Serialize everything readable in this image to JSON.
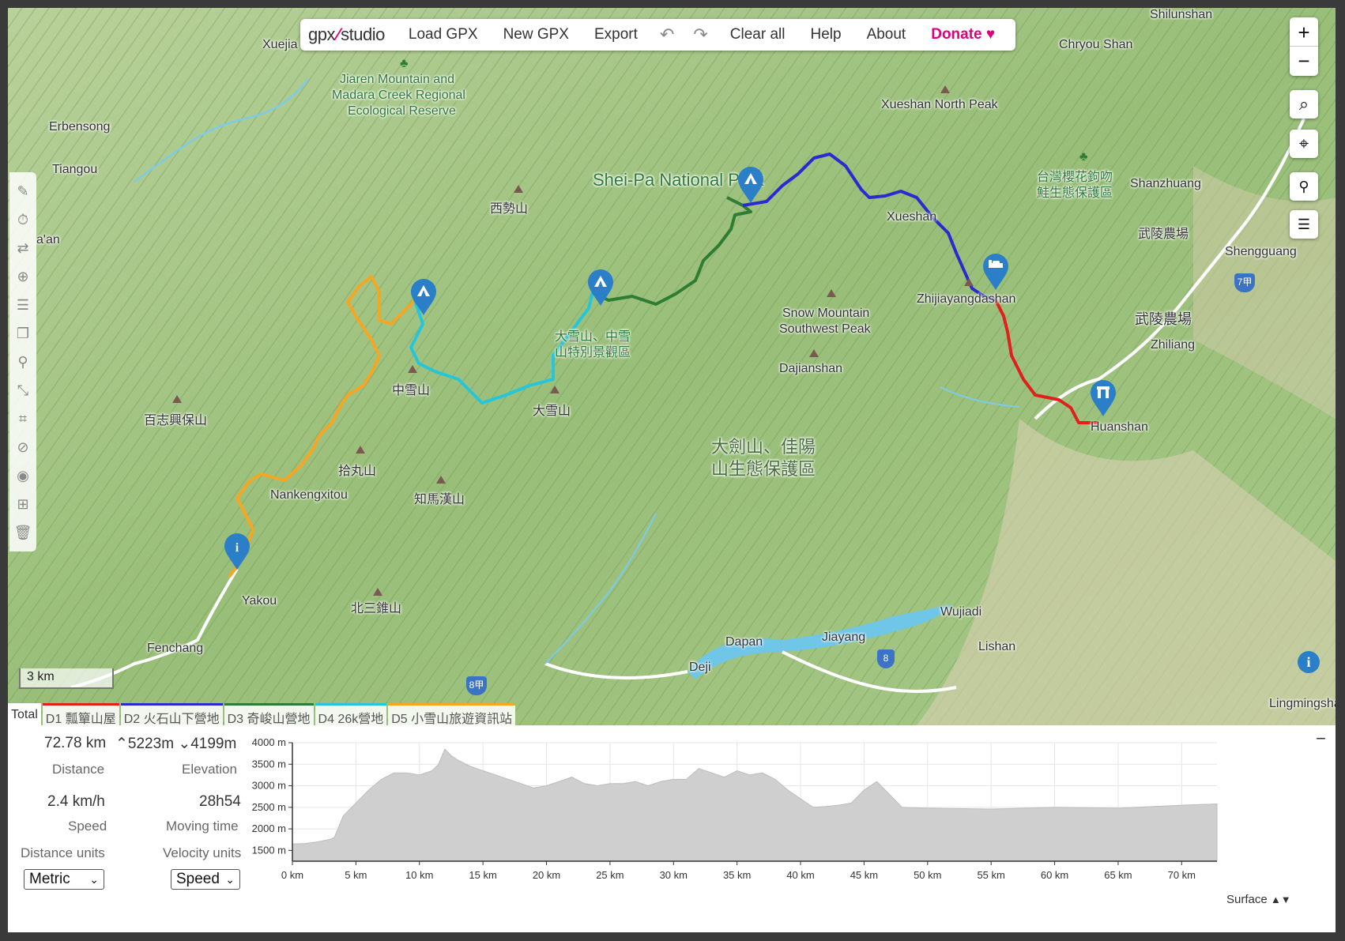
{
  "toolbar": {
    "logo_left": "gpx",
    "logo_right": "studio",
    "load": "Load GPX",
    "new": "New GPX",
    "export": "Export",
    "undo_icon": "undo-icon",
    "redo_icon": "redo-icon",
    "clear": "Clear all",
    "help": "Help",
    "about": "About",
    "donate": "Donate"
  },
  "map": {
    "labels": {
      "xuejia": "Xuejia",
      "reserve1": "Jiaren Mountain and",
      "reserve2": "Madara Creek Regional",
      "reserve3": "Ecological Reserve",
      "erbensong": "Erbensong",
      "tiangou": "Tiangou",
      "aan": "a'an",
      "xishi": "西勢山",
      "sheipa": "Shei-Pa National Park",
      "shilunshan": "Shilunshan",
      "chryou": "Chryou Shan",
      "xueshan_north": "Xueshan North Peak",
      "sakura1": "台灣櫻花鉤吻",
      "sakura2": "鮭生態保護區",
      "shanzhuang": "Shanzhuang",
      "wuling_farm_small": "武陵農場",
      "shengguang": "Shengguang",
      "wuling_farm": "武陵農場",
      "zhiliang": "Zhiliang",
      "xueshan": "Xueshan",
      "zhijiayang": "Zhijiayangdashan",
      "snow_sw1": "Snow Mountain",
      "snow_sw2": "Southwest Peak",
      "dajianshan": "Dajianshan",
      "huanshan": "Huanshan",
      "daxue_area1": "大雪山、中雪",
      "daxue_area2": "山特別景觀區",
      "zhongxue": "中雪山",
      "daxue": "大雪山",
      "baizhi": "百志興保山",
      "shiwan": "拾丸山",
      "zhima": "知馬漢山",
      "nankeng": "Nankengxitou",
      "yakou": "Yakou",
      "beisan": "北三錐山",
      "fenchang": "Fenchang",
      "dajian_reserve1": "大劍山、佳陽",
      "dajian_reserve2": "山生態保護區",
      "dapan": "Dapan",
      "jiayang": "Jiayang",
      "wujiadi": "Wujiadi",
      "lishan": "Lishan",
      "deji": "Deji",
      "lingmingsha": "Lingmingsha",
      "route_7": "7甲",
      "route_8": "8",
      "route_8a": "8甲"
    },
    "scale": "3 km",
    "zoom_in": "+",
    "zoom_out": "−"
  },
  "tabs": [
    {
      "label": "Total",
      "color": "#ffffff"
    },
    {
      "label": "D1 瓢簞山屋",
      "color": "#e0201c"
    },
    {
      "label": "D2 火石山下營地",
      "color": "#2a2ad0"
    },
    {
      "label": "D3 奇峻山營地",
      "color": "#2e7d32"
    },
    {
      "label": "D4 26k營地",
      "color": "#26c6da"
    },
    {
      "label": "D5 小雪山旅遊資訊站",
      "color": "#f5a623"
    }
  ],
  "stats": {
    "distance": "72.78 km",
    "elev_up": "5223m",
    "elev_down": "4199m",
    "distance_label": "Distance",
    "elevation_label": "Elevation",
    "speed": "2.4 km/h",
    "moving_time": "28h54",
    "speed_label": "Speed",
    "moving_time_label": "Moving time",
    "distance_units_label": "Distance units",
    "velocity_units_label": "Velocity units",
    "distance_units_value": "Metric",
    "velocity_units_value": "Speed",
    "surface": "Surface"
  },
  "chart_data": {
    "type": "area",
    "xlabel": "",
    "ylabel": "",
    "x_ticks": [
      "0 km",
      "5 km",
      "10 km",
      "15 km",
      "20 km",
      "25 km",
      "30 km",
      "35 km",
      "40 km",
      "45 km",
      "50 km",
      "55 km",
      "60 km",
      "65 km",
      "70 km"
    ],
    "y_ticks": [
      "1500 m",
      "2000 m",
      "2500 m",
      "3000 m",
      "3500 m",
      "4000 m"
    ],
    "xlim": [
      0,
      72.78
    ],
    "ylim": [
      1250,
      4000
    ],
    "x": [
      0,
      1,
      2,
      3,
      3.3,
      4,
      5,
      6,
      7,
      8,
      9,
      10,
      11,
      11.5,
      12,
      12.5,
      13,
      14,
      15,
      16,
      17,
      18,
      19,
      20,
      21,
      22,
      23,
      24,
      25,
      26,
      27,
      28,
      29,
      30,
      31,
      32,
      33,
      34,
      35,
      36,
      37,
      38,
      39,
      40,
      41,
      42,
      43,
      44,
      45,
      46,
      47,
      48,
      50,
      55,
      60,
      65,
      70,
      72.78
    ],
    "y": [
      1650,
      1660,
      1700,
      1760,
      1800,
      2300,
      2600,
      2900,
      3150,
      3300,
      3300,
      3250,
      3350,
      3500,
      3850,
      3700,
      3600,
      3450,
      3350,
      3250,
      3150,
      3050,
      2950,
      3000,
      3100,
      3200,
      3050,
      3000,
      3050,
      3050,
      3100,
      3000,
      3100,
      3150,
      3150,
      3400,
      3300,
      3200,
      3350,
      3250,
      3300,
      3150,
      2900,
      2700,
      2500,
      2520,
      2550,
      2600,
      2900,
      3100,
      2800,
      2500,
      2480,
      2460,
      2500,
      2480,
      2550,
      2580
    ]
  }
}
